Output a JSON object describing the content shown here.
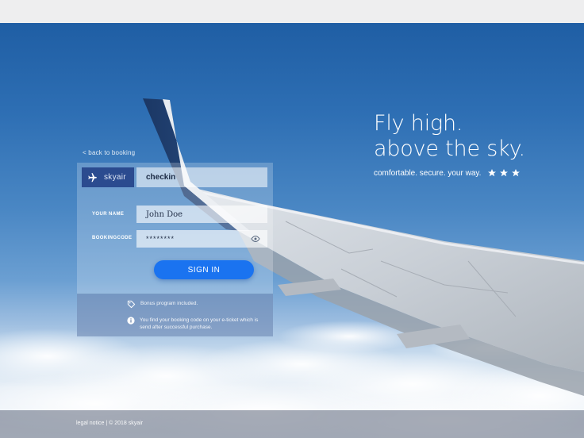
{
  "nav": {
    "back_label": "< back to booking"
  },
  "brand": {
    "name": "skyair",
    "icon": "plane-icon"
  },
  "panel": {
    "active_tab": "checkin",
    "fields": {
      "name_label": "YOUR NAME",
      "name_value": "John Doe",
      "code_label": "BOOKINGCODE",
      "code_value": "********"
    },
    "signin_label": "SIGN IN",
    "info": {
      "bonus": "Bonus program included.",
      "ticket": "You find your booking code on your e-ticket which is send after successful purchase."
    }
  },
  "hero": {
    "line1": "Fly high.",
    "line2": "above the sky.",
    "tagline": "comfortable. secure. your way.",
    "stars_count": 3
  },
  "footer": {
    "legal": "legal notice | © 2018 skyair"
  },
  "colors": {
    "accent": "#1a73f0",
    "brand": "#2b4b8f",
    "sky": "#2e6fb4"
  }
}
